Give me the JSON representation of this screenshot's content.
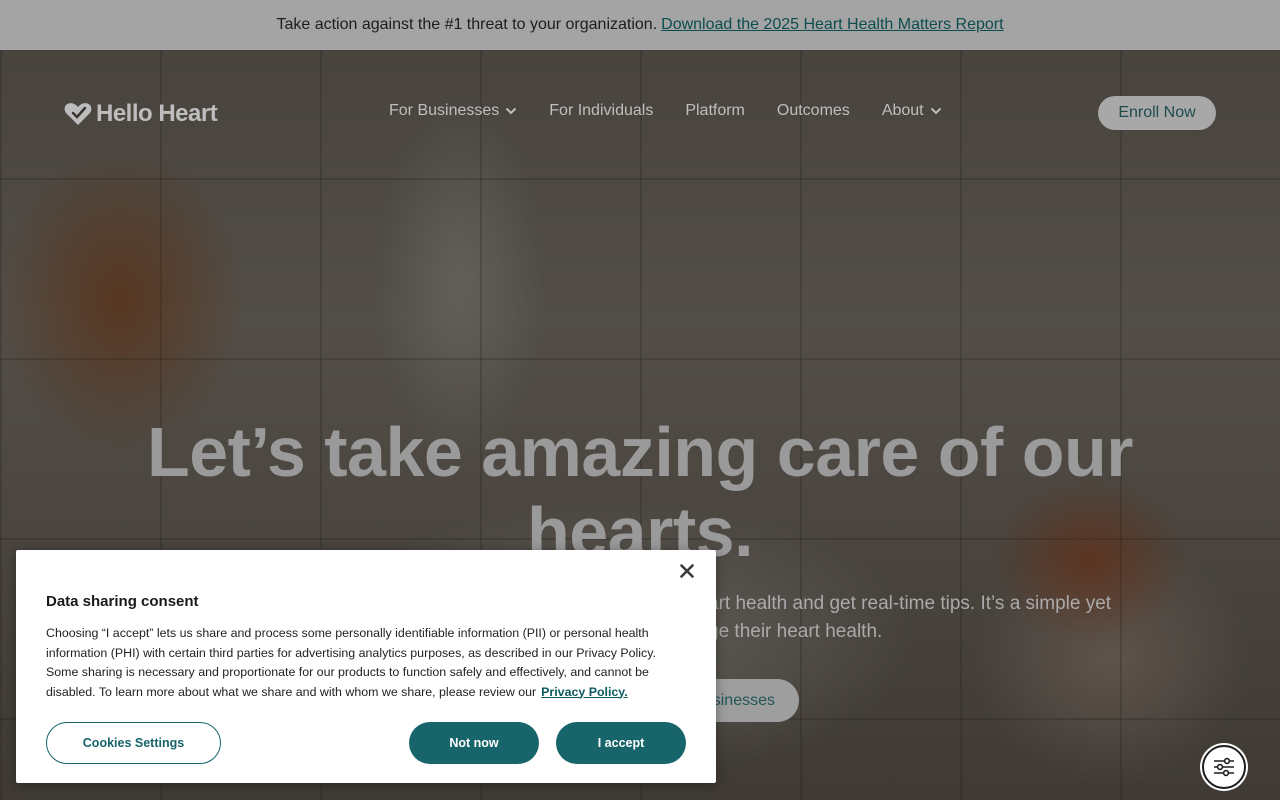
{
  "promo": {
    "text": "Take action against the #1 threat to your organization.",
    "link": "Download the 2025 Heart Health Matters Report"
  },
  "nav": {
    "logo_text": "Hello Heart",
    "items": [
      {
        "label": "For Businesses",
        "has_dropdown": true
      },
      {
        "label": "For Individuals",
        "has_dropdown": false
      },
      {
        "label": "Platform",
        "has_dropdown": false
      },
      {
        "label": "Outcomes",
        "has_dropdown": false
      },
      {
        "label": "About",
        "has_dropdown": true
      }
    ],
    "cta": "Enroll Now"
  },
  "hero": {
    "headline_line1": "Let’s take amazing care of our",
    "headline_line2": "hearts.",
    "subtext_line1": "art health and get real-time tips. It’s a simple yet",
    "subtext_line2": "ge their heart health.",
    "button_partial": "sinesses"
  },
  "consent": {
    "title": "Data sharing consent",
    "body": "Choosing “I accept” lets us share and process some personally identifiable information (PII) or personal health information (PHI) with certain third parties for advertising analytics purposes, as described in our Privacy Policy. Some sharing is necessary and proportionate for our products to function safely and effectively, and cannot be disabled. To learn more about what we share and with whom we share, please review our",
    "privacy_link": "Privacy Policy.",
    "settings_button": "Cookies Settings",
    "reject_button": "Not now",
    "accept_button": "I accept"
  },
  "colors": {
    "brand_teal": "#17656a",
    "promo_bg": "#a4a4a4"
  },
  "icons": {
    "close": "close-icon",
    "prefs": "sliders-icon",
    "chevron": "chevron-down-icon",
    "logo": "heart-logo-icon"
  }
}
